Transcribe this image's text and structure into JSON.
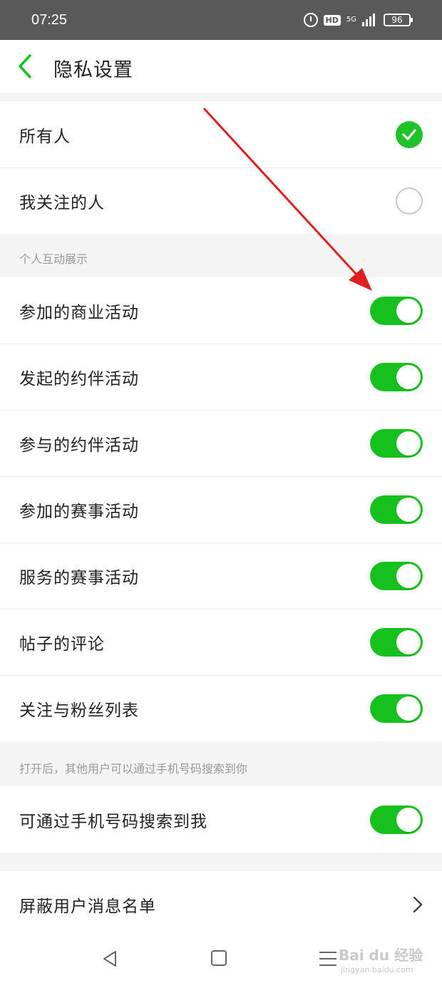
{
  "status_bar": {
    "time": "07:25",
    "hd_label": "HD",
    "network_label": "5G",
    "battery": "96",
    "icons": [
      "alarm-icon",
      "hd-icon",
      "5g-icon",
      "signal-icon",
      "battery-icon"
    ]
  },
  "header": {
    "title": "隐私设置",
    "back_icon": "chevron-left-icon"
  },
  "colors": {
    "accent": "#16c11e",
    "arrow": "#e02020",
    "status_bar": "#595959"
  },
  "visibility": {
    "options": [
      {
        "label": "所有人",
        "selected": true
      },
      {
        "label": "我关注的人",
        "selected": false
      }
    ]
  },
  "interaction_section": {
    "title": "个人互动展示",
    "items": [
      {
        "label": "参加的商业活动",
        "on": true
      },
      {
        "label": "发起的约伴活动",
        "on": true
      },
      {
        "label": "参与的约伴活动",
        "on": true
      },
      {
        "label": "参加的赛事活动",
        "on": true
      },
      {
        "label": "服务的赛事活动",
        "on": true
      },
      {
        "label": "帖子的评论",
        "on": true
      },
      {
        "label": "关注与粉丝列表",
        "on": true
      }
    ]
  },
  "phone_section": {
    "hint": "打开后，其他用户可以通过手机号码搜索到你",
    "item": {
      "label": "可通过手机号码搜索到我",
      "on": true
    }
  },
  "block_section": {
    "label": "屏蔽用户消息名单"
  },
  "watermark": {
    "brand": "Bai du 经验",
    "url": "jingyan.baidu.com"
  }
}
